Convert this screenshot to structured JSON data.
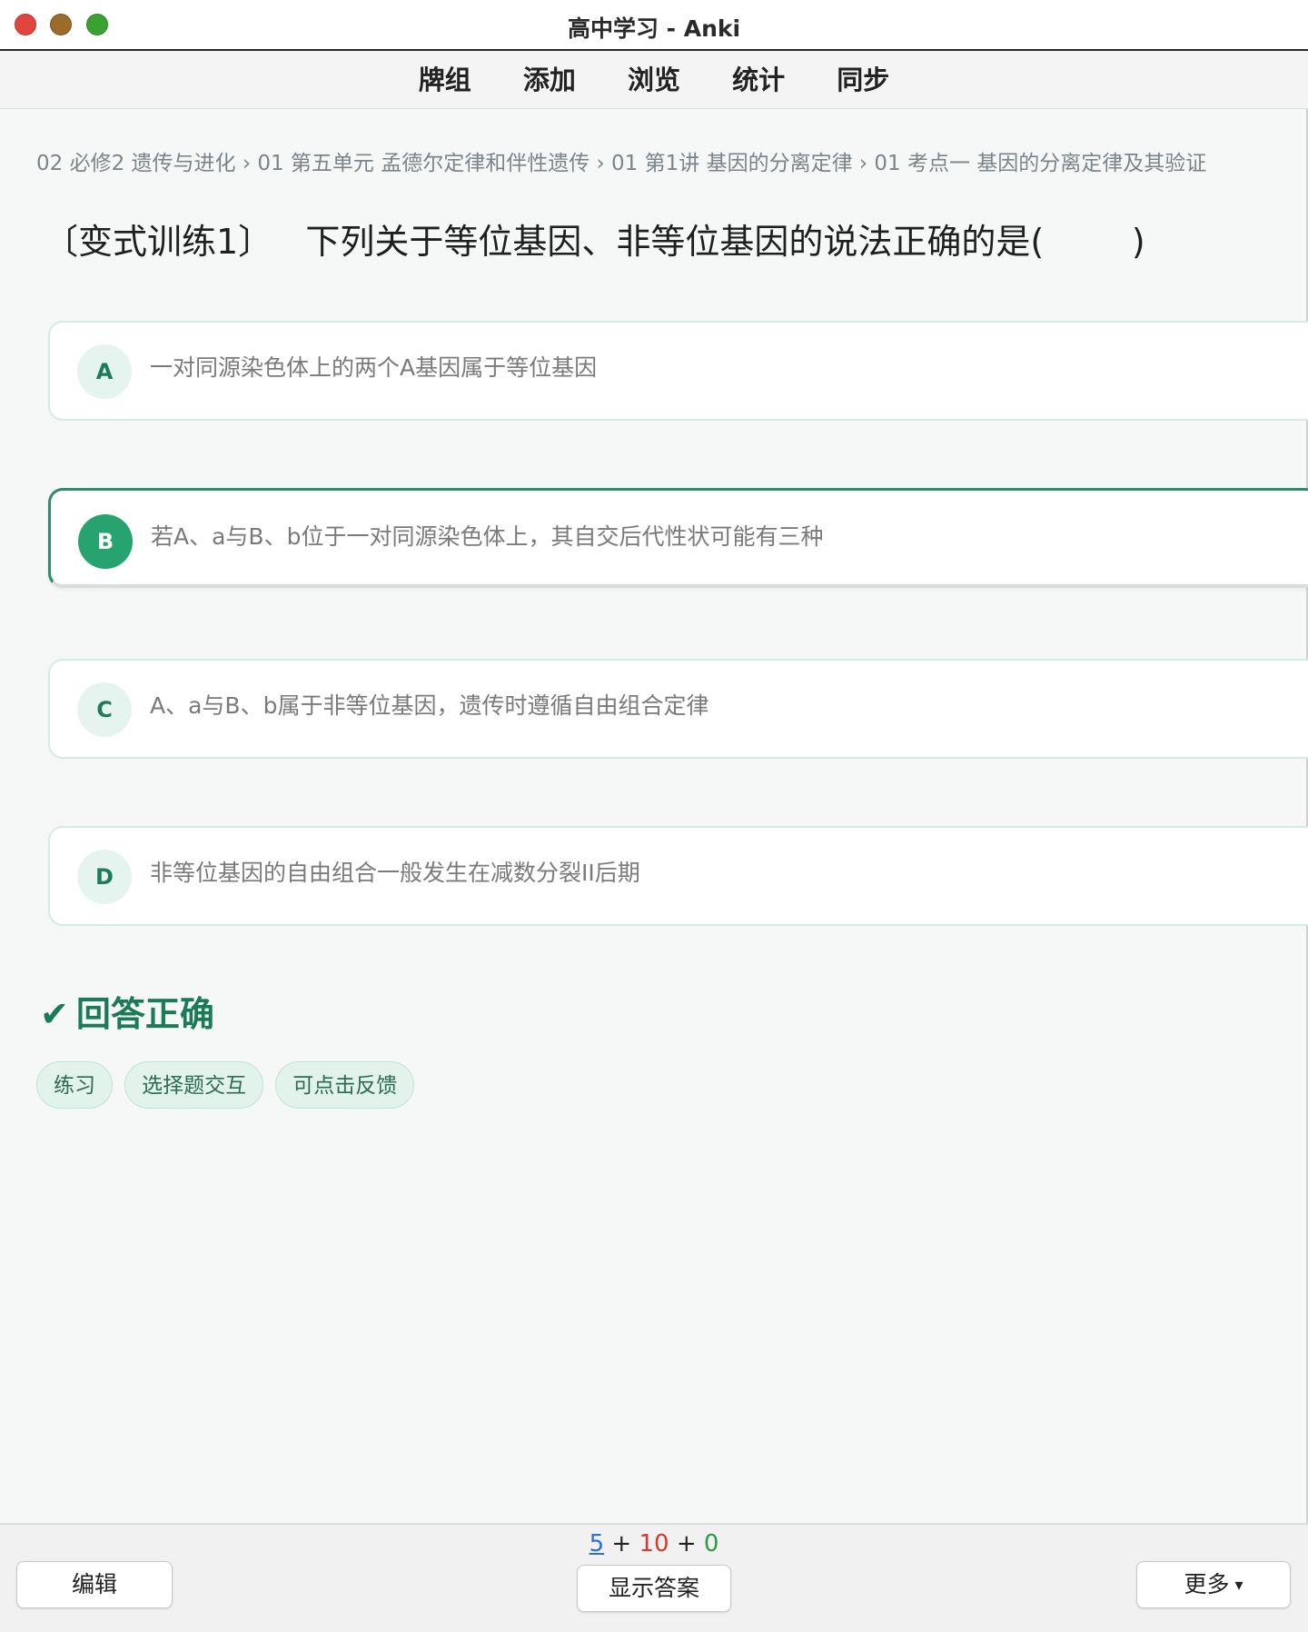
{
  "window": {
    "title": "高中学习 - Anki"
  },
  "toolbar": {
    "items": [
      "牌组",
      "添加",
      "浏览",
      "统计",
      "同步"
    ]
  },
  "breadcrumb": "02 必修2 遗传与进化 › 01 第五单元 孟德尔定律和伴性遗传 › 01 第1讲 基因的分离定律 › 01 考点一 基因的分离定律及其验证",
  "question": "〔变式训练1〕   下列关于等位基因、非等位基因的说法正确的是(        )",
  "options": [
    {
      "letter": "A",
      "text": "一对同源染色体上的两个A基因属于等位基因"
    },
    {
      "letter": "B",
      "text": "若A、a与B、b位于一对同源染色体上，其自交后代性状可能有三种"
    },
    {
      "letter": "C",
      "text": "A、a与B、b属于非等位基因，遗传时遵循自由组合定律"
    },
    {
      "letter": "D",
      "text": "非等位基因的自由组合一般发生在减数分裂II后期"
    }
  ],
  "selected_option": "B",
  "result": {
    "check": "✔",
    "text": "回答正确"
  },
  "tags": [
    "练习",
    "选择题交互",
    "可点击反馈"
  ],
  "bottom": {
    "edit_label": "编辑",
    "counts": {
      "new": "5",
      "learn": "10",
      "review": "0",
      "sep": "+"
    },
    "show_answer_label": "显示答案",
    "more_label": "更多",
    "more_caret": "▾"
  },
  "colors": {
    "accent": "#26a36f",
    "correct": "#1b7a57",
    "new_count": "#2f6ed6",
    "learn_count": "#d33b2f",
    "review_count": "#2f9a43"
  }
}
